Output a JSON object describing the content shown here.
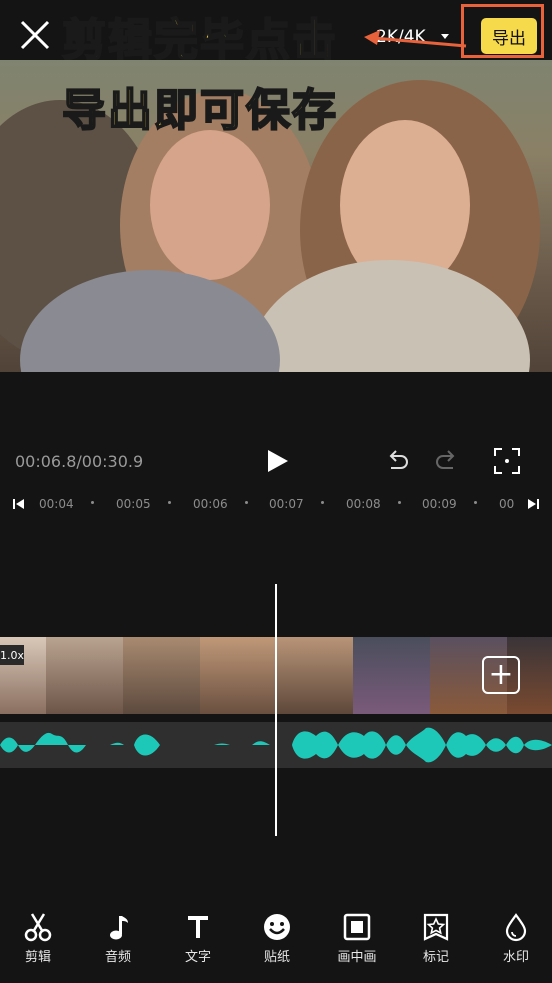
{
  "annotation": {
    "line1": "剪辑完毕点击",
    "line2": "导出即可保存"
  },
  "header": {
    "resolution": "2K/4K",
    "export_label": "导出"
  },
  "player": {
    "timecode": "00:06.8/00:30.9"
  },
  "ruler": {
    "ticks": [
      "00:04",
      "00:05",
      "00:06",
      "00:07",
      "00:08",
      "00:09",
      "00"
    ]
  },
  "timeline": {
    "speed": "1.0x",
    "add_symbol": "+"
  },
  "toolbar": {
    "items": [
      {
        "icon": "scissors-icon",
        "label": "剪辑"
      },
      {
        "icon": "music-note-icon",
        "label": "音频"
      },
      {
        "icon": "text-icon",
        "label": "文字"
      },
      {
        "icon": "sticker-smile-icon",
        "label": "贴纸"
      },
      {
        "icon": "picture-in-picture-icon",
        "label": "画中画"
      },
      {
        "icon": "star-marker-icon",
        "label": "标记"
      },
      {
        "icon": "water-drop-icon",
        "label": "水印"
      }
    ]
  },
  "colors": {
    "accent": "#f7d94c",
    "highlight_border": "#e8633c",
    "waveform": "#1ec8b8"
  }
}
